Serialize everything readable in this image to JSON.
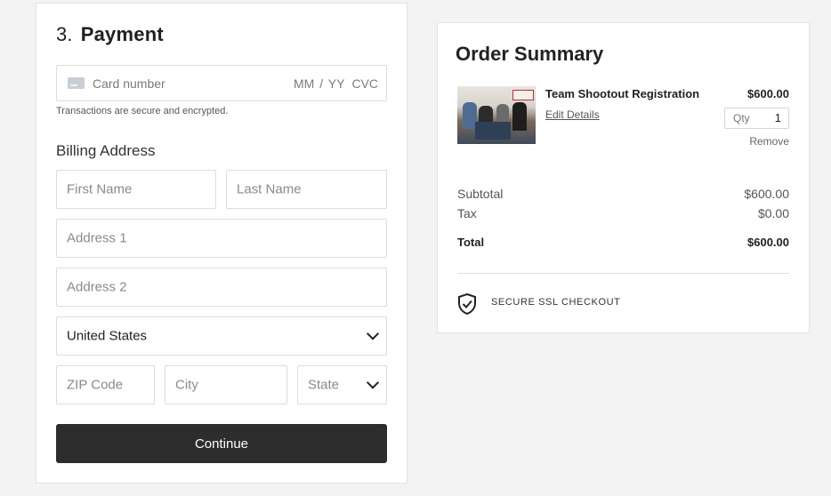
{
  "payment": {
    "step_number": "3.",
    "title": "Payment",
    "card": {
      "number_placeholder": "Card number",
      "expiry_placeholder": "MM / YY",
      "cvc_placeholder": "CVC"
    },
    "secure_note": "Transactions are secure and encrypted.",
    "billing_heading": "Billing Address",
    "fields": {
      "first_name": "First Name",
      "last_name": "Last Name",
      "address1": "Address 1",
      "address2": "Address 2",
      "country": "United States",
      "zip": "ZIP Code",
      "city": "City",
      "state": "State"
    },
    "continue_label": "Continue"
  },
  "summary": {
    "title": "Order Summary",
    "item": {
      "name": "Team Shootout Registration",
      "edit_label": "Edit Details",
      "price": "$600.00",
      "qty_label": "Qty",
      "qty": "1",
      "remove_label": "Remove"
    },
    "subtotal_label": "Subtotal",
    "subtotal": "$600.00",
    "tax_label": "Tax",
    "tax": "$0.00",
    "total_label": "Total",
    "total": "$600.00",
    "ssl_label": "SECURE SSL CHECKOUT"
  },
  "colors": {
    "button_bg": "#2d2d2d",
    "page_bg": "#f3f3f3"
  }
}
